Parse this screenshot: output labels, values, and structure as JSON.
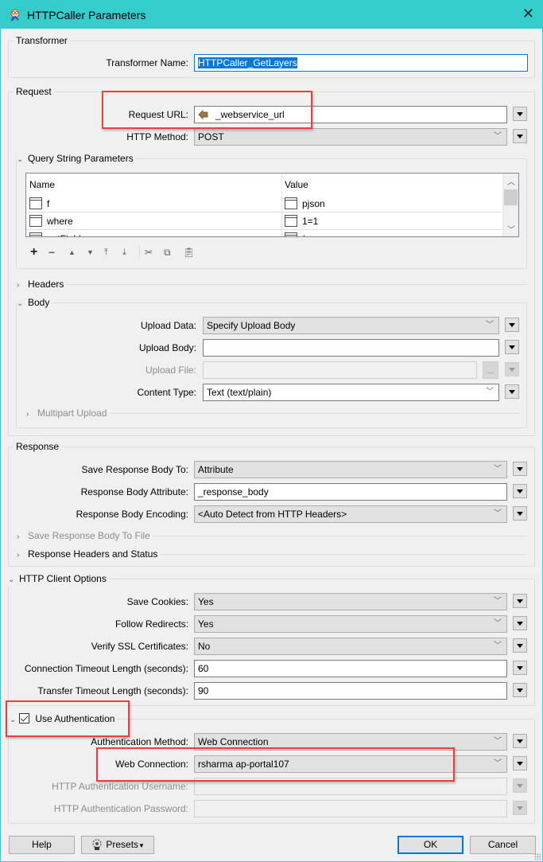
{
  "window": {
    "title": "HTTPCaller Parameters",
    "app_icon": "fme-transformer-icon",
    "close_icon": "✕"
  },
  "transformer": {
    "group_title": "Transformer",
    "name_label": "Transformer Name:",
    "name_value": "HTTPCaller_GetLayers"
  },
  "request": {
    "group_title": "Request",
    "url_label": "Request URL:",
    "url_value": "_webservice_url",
    "url_value_icon": "attribute-icon",
    "method_label": "HTTP Method:",
    "method_value": "POST",
    "query_params": {
      "title": "Query String Parameters",
      "expanded": true,
      "columns": [
        "Name",
        "Value"
      ],
      "rows": [
        {
          "name": "f",
          "value": "pjson"
        },
        {
          "name": "where",
          "value": "1=1"
        },
        {
          "name": "outFields",
          "value": "*"
        }
      ],
      "toolbar": [
        "add",
        "remove",
        "move-up",
        "move-down",
        "move-top",
        "move-bottom",
        "cut",
        "copy",
        "paste"
      ]
    },
    "headers": {
      "title": "Headers",
      "expanded": false
    },
    "body": {
      "title": "Body",
      "expanded": true,
      "upload_data_label": "Upload Data:",
      "upload_data_value": "Specify Upload Body",
      "upload_body_label": "Upload Body:",
      "upload_body_value": "",
      "upload_file_label": "Upload File:",
      "upload_file_value": "",
      "browse_label": "...",
      "content_type_label": "Content Type:",
      "content_type_value": "Text (text/plain)",
      "multipart_title": "Multipart Upload"
    }
  },
  "response": {
    "group_title": "Response",
    "save_to_label": "Save Response Body To:",
    "save_to_value": "Attribute",
    "attribute_label": "Response Body Attribute:",
    "attribute_value": "_response_body",
    "encoding_label": "Response Body Encoding:",
    "encoding_value": "<Auto Detect from HTTP Headers>",
    "save_to_file_title": "Save Response Body To File",
    "headers_status_title": "Response Headers and Status"
  },
  "client_options": {
    "title": "HTTP Client Options",
    "save_cookies_label": "Save Cookies:",
    "save_cookies_value": "Yes",
    "follow_redirects_label": "Follow Redirects:",
    "follow_redirects_value": "Yes",
    "verify_ssl_label": "Verify SSL Certificates:",
    "verify_ssl_value": "No",
    "conn_timeout_label": "Connection Timeout Length (seconds):",
    "conn_timeout_value": "60",
    "transfer_timeout_label": "Transfer Timeout Length (seconds):",
    "transfer_timeout_value": "90"
  },
  "authentication": {
    "title": "Use Authentication",
    "checked": true,
    "method_label": "Authentication Method:",
    "method_value": "Web Connection",
    "web_connection_label": "Web Connection:",
    "web_connection_value": "rsharma ap-portal107",
    "username_label": "HTTP Authentication Username:",
    "username_value": "",
    "password_label": "HTTP Authentication Password:",
    "password_value": ""
  },
  "footer": {
    "help_label": "Help",
    "presets_label": "Presets",
    "ok_label": "OK",
    "cancel_label": "Cancel"
  },
  "colors": {
    "titlebar": "#35cccc",
    "highlight_box": "#e8403c",
    "selection": "#0078d7"
  }
}
